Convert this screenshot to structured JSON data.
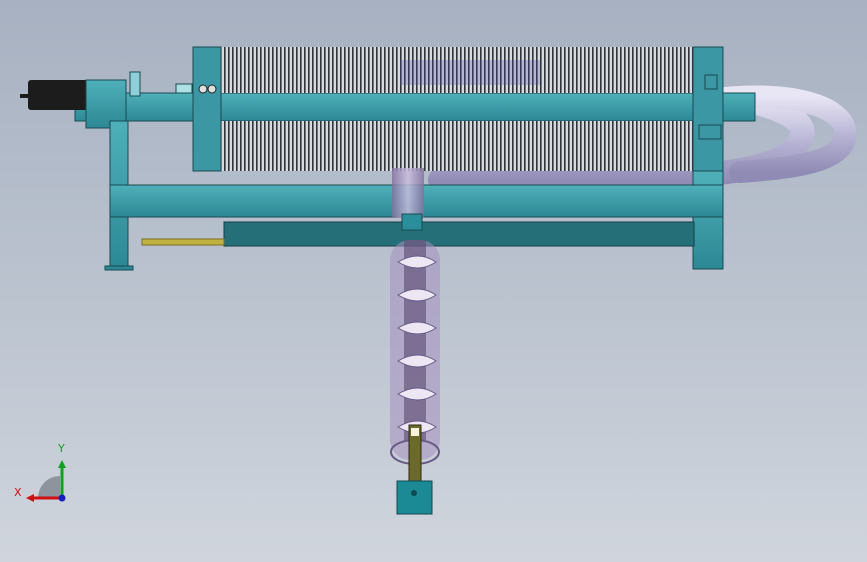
{
  "viewport": {
    "title": "",
    "colors": {
      "frame": "#3b98a4",
      "frame_dark": "#1f6f7c",
      "plates": "#b9bec4",
      "pipe": "#c4c2dc",
      "auger": "#d8cfe4",
      "rod": "#c0b240",
      "motor": "#1c1c1c",
      "box": "#1c8a94"
    }
  },
  "triad": {
    "x_label": "X",
    "y_label": "Y",
    "x_color": "#d01010",
    "y_color": "#10a020",
    "z_color": "#1020c0"
  }
}
